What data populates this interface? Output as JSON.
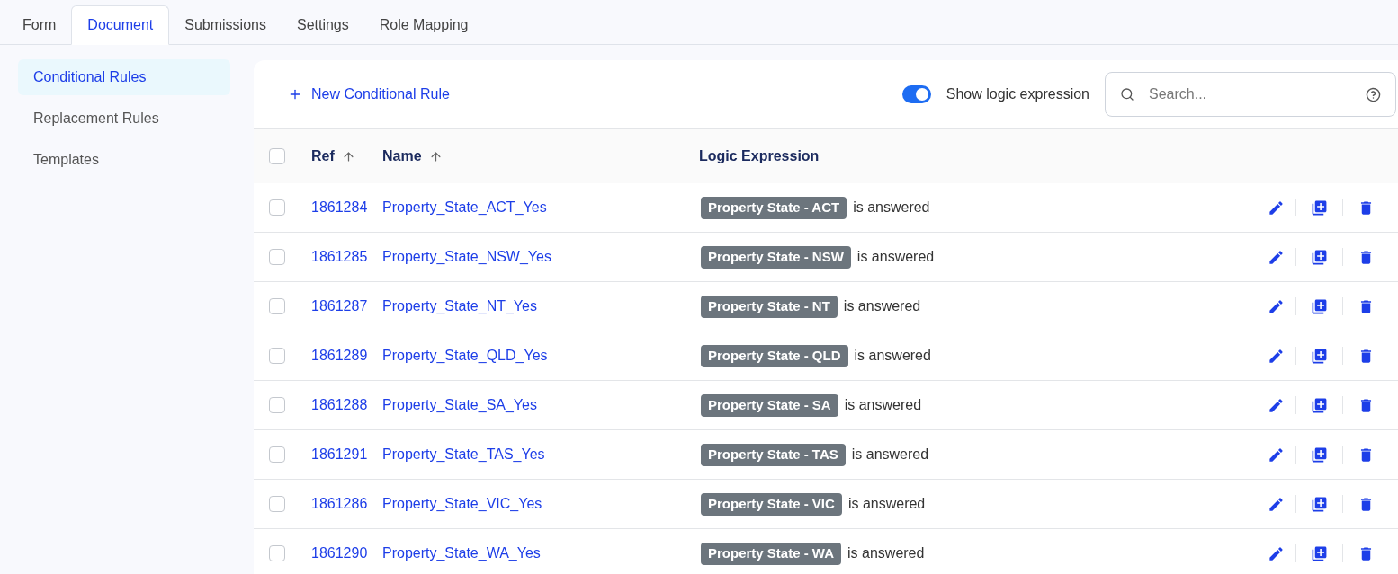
{
  "tabs": [
    {
      "label": "Form",
      "selected": false
    },
    {
      "label": "Document",
      "selected": true
    },
    {
      "label": "Submissions",
      "selected": false
    },
    {
      "label": "Settings",
      "selected": false
    },
    {
      "label": "Role Mapping",
      "selected": false
    }
  ],
  "sidebar": {
    "items": [
      {
        "label": "Conditional Rules",
        "selected": true
      },
      {
        "label": "Replacement Rules",
        "selected": false
      },
      {
        "label": "Templates",
        "selected": false
      }
    ]
  },
  "toolbar": {
    "new_button": "New Conditional Rule",
    "toggle": {
      "label": "Show logic expression",
      "on": true
    },
    "search": {
      "placeholder": "Search..."
    }
  },
  "table": {
    "select_all_checked": false,
    "columns": [
      "Ref",
      "Name",
      "Logic Expression"
    ],
    "rows": [
      {
        "checked": false,
        "ref": "1861284",
        "name": "Property_State_ACT_Yes",
        "tag": "Property State - ACT",
        "condition": "is answered"
      },
      {
        "checked": false,
        "ref": "1861285",
        "name": "Property_State_NSW_Yes",
        "tag": "Property State - NSW",
        "condition": "is answered"
      },
      {
        "checked": false,
        "ref": "1861287",
        "name": "Property_State_NT_Yes",
        "tag": "Property State - NT",
        "condition": "is answered"
      },
      {
        "checked": false,
        "ref": "1861289",
        "name": "Property_State_QLD_Yes",
        "tag": "Property State - QLD",
        "condition": "is answered"
      },
      {
        "checked": false,
        "ref": "1861288",
        "name": "Property_State_SA_Yes",
        "tag": "Property State - SA",
        "condition": "is answered"
      },
      {
        "checked": false,
        "ref": "1861291",
        "name": "Property_State_TAS_Yes",
        "tag": "Property State - TAS",
        "condition": "is answered"
      },
      {
        "checked": false,
        "ref": "1861286",
        "name": "Property_State_VIC_Yes",
        "tag": "Property State - VIC",
        "condition": "is answered"
      },
      {
        "checked": false,
        "ref": "1861290",
        "name": "Property_State_WA_Yes",
        "tag": "Property State - WA",
        "condition": "is answered"
      }
    ]
  }
}
